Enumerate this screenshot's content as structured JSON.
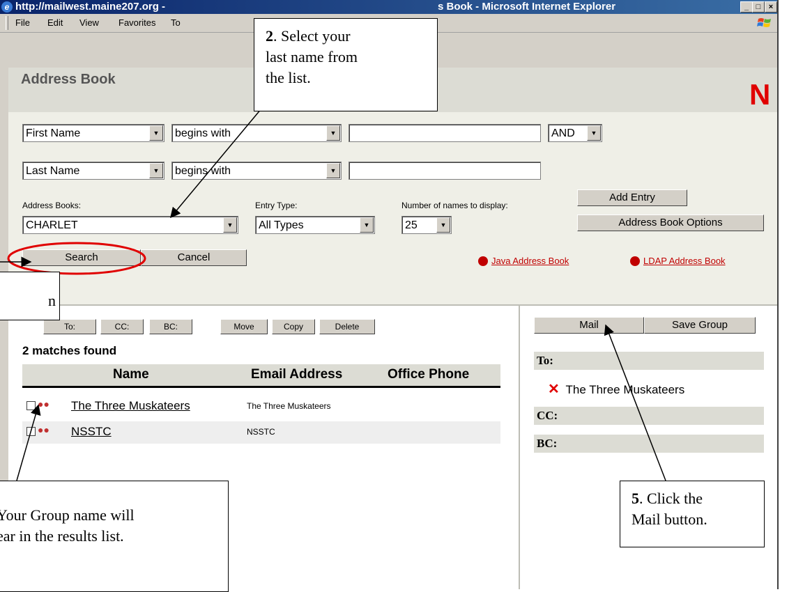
{
  "window": {
    "title": "http://mailwest.maine207.org - Address Book - Microsoft Internet Explorer",
    "title_left": "http://mailwest.maine207.org -",
    "title_right": "s Book - Microsoft Internet Explorer",
    "minimize": "_",
    "maximize": "□",
    "close": "×"
  },
  "menubar": {
    "items": [
      "File",
      "Edit",
      "View",
      "Favorites",
      "To"
    ]
  },
  "header": {
    "title": "Address Book",
    "logo": "N"
  },
  "search": {
    "row1": {
      "field": "First Name",
      "operator": "begins with",
      "value": "",
      "conjunction": "AND"
    },
    "row2": {
      "field": "Last Name",
      "operator": "begins with",
      "value": ""
    },
    "address_books_label": "Address Books:",
    "address_book": "CHARLET",
    "entry_type_label": "Entry Type:",
    "entry_type": "All Types",
    "count_label": "Number of names to display:",
    "count": "25",
    "add_entry": "Add Entry",
    "options": "Address Book Options",
    "search_button": "Search",
    "cancel_button": "Cancel",
    "java_link": "Java Address Book",
    "ldap_link": "LDAP Address Book"
  },
  "results": {
    "buttons": {
      "to": "To:",
      "cc": "CC:",
      "bc": "BC:",
      "move": "Move",
      "copy": "Copy",
      "delete": "Delete"
    },
    "count_text": "2 matches found",
    "columns": [
      "Name",
      "Email Address",
      "Office Phone"
    ],
    "rows": [
      {
        "name": "The Three Muskateers",
        "email": "The Three Muskateers"
      },
      {
        "name": "NSSTC",
        "email": "NSSTC"
      }
    ]
  },
  "recipients": {
    "mail_button": "Mail",
    "save_group_button": "Save Group",
    "to_label": "To:",
    "to_entry": "The Three Muskateers",
    "cc_label": "CC:",
    "bc_label": "BC:"
  },
  "callouts": {
    "step2_num": "2",
    "step2_line1": ". Select your",
    "step2_line2": "last name from",
    "step2_line3": "the list.",
    "step5_num": "5",
    "step5_line1": ". Click the",
    "step5_line2": "Mail button.",
    "step4_line1": "Your Group name will",
    "step4_line2": "ear in the results list.",
    "step3_fragment": "n"
  }
}
